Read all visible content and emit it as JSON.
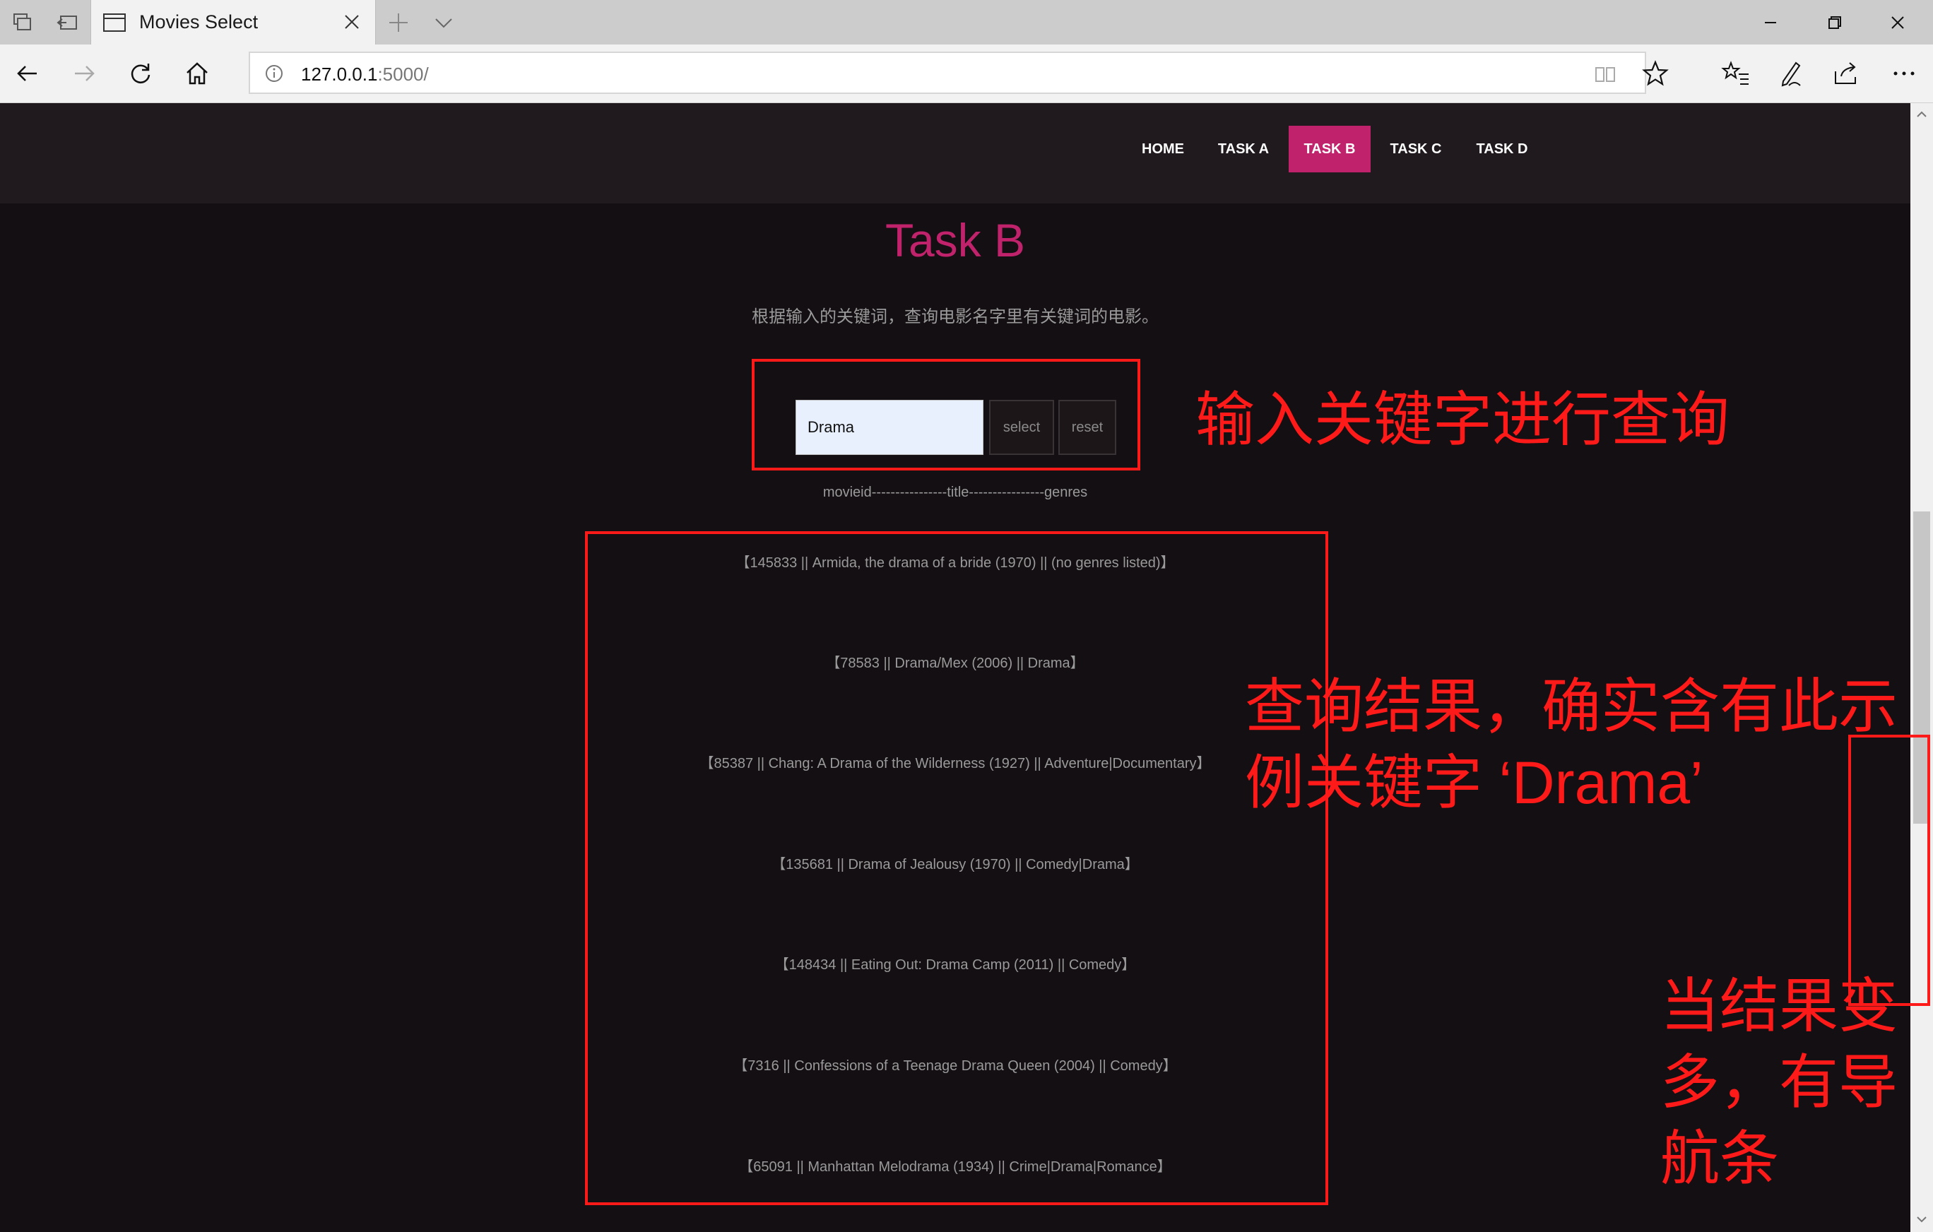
{
  "browser": {
    "tab_title": "Movies Select",
    "url_host": "127.0.0.1",
    "url_rest": ":5000/"
  },
  "site_nav": {
    "items": [
      {
        "label": "HOME",
        "active": false
      },
      {
        "label": "TASK A",
        "active": false
      },
      {
        "label": "TASK B",
        "active": true
      },
      {
        "label": "TASK C",
        "active": false
      },
      {
        "label": "TASK D",
        "active": false
      }
    ]
  },
  "page": {
    "heading": "Task B",
    "subtitle": "根据输入的关键词，查询电影名字里有关键词的电影。",
    "search": {
      "value": "Drama",
      "select_label": "select",
      "reset_label": "reset"
    },
    "column_header": "movieid----------------title----------------genres",
    "results": [
      "【145833 || Armida, the drama of a bride (1970) || (no genres listed)】",
      "【78583 || Drama/Mex (2006) || Drama】",
      "【85387 || Chang: A Drama of the Wilderness (1927) || Adventure|Documentary】",
      "【135681 || Drama of Jealousy (1970) || Comedy|Drama】",
      "【148434 || Eating Out: Drama Camp (2011) || Comedy】",
      "【7316 || Confessions of a Teenage Drama Queen (2004) || Comedy】",
      "【65091 || Manhattan Melodrama (1934) || Crime|Drama|Romance】"
    ]
  },
  "annotations": {
    "search_note": "输入关键字进行查询",
    "result_note_line1": "查询结果，确实含有此示",
    "result_note_line2": "例关键字 ‘Drama’",
    "scroll_note_line1": "当结果变",
    "scroll_note_line2": "多，有导",
    "scroll_note_line3": "航条"
  },
  "colors": {
    "accent": "#c0236b",
    "annotation": "#ff1a1a",
    "page_bg": "#140f12"
  }
}
